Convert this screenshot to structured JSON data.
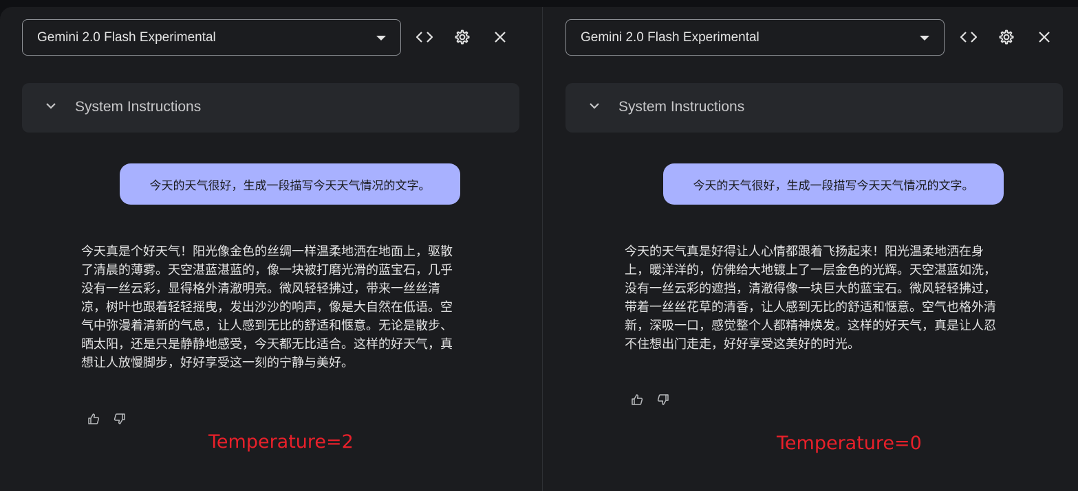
{
  "panes": [
    {
      "model_select": {
        "value": "Gemini 2.0 Flash Experimental"
      },
      "toolbar": {
        "code_icon": "code-icon",
        "settings_icon": "gear-icon",
        "close_icon": "close-icon"
      },
      "system_instructions": {
        "label": "System Instructions"
      },
      "user_message": "今天的天气很好，生成一段描写今天天气情况的文字。",
      "response": "今天真是个好天气！阳光像金色的丝绸一样温柔地洒在地面上，驱散了清晨的薄雾。天空湛蓝湛蓝的，像一块被打磨光滑的蓝宝石，几乎没有一丝云彩，显得格外清澈明亮。微风轻轻拂过，带来一丝丝清凉，树叶也跟着轻轻摇曳，发出沙沙的响声，像是大自然在低语。空气中弥漫着清新的气息，让人感到无比的舒适和惬意。无论是散步、晒太阳，还是只是静静地感受，今天都无比适合。这样的好天气，真想让人放慢脚步，好好享受这一刻的宁静与美好。",
      "feedback": {
        "like_icon": "thumbs-up-icon",
        "dislike_icon": "thumbs-down-icon"
      },
      "annotation": "Temperature=2"
    },
    {
      "model_select": {
        "value": "Gemini 2.0 Flash Experimental"
      },
      "toolbar": {
        "code_icon": "code-icon",
        "settings_icon": "gear-icon",
        "close_icon": "close-icon"
      },
      "system_instructions": {
        "label": "System Instructions"
      },
      "user_message": "今天的天气很好，生成一段描写今天天气情况的文字。",
      "response": "今天的天气真是好得让人心情都跟着飞扬起来！阳光温柔地洒在身上，暖洋洋的，仿佛给大地镀上了一层金色的光辉。天空湛蓝如洗，没有一丝云彩的遮挡，清澈得像一块巨大的蓝宝石。微风轻轻拂过，带着一丝丝花草的清香，让人感到无比的舒适和惬意。空气也格外清新，深吸一口，感觉整个人都精神焕发。这样的好天气，真是让人忍不住想出门走走，好好享受这美好的时光。",
      "feedback": {
        "like_icon": "thumbs-up-icon",
        "dislike_icon": "thumbs-down-icon"
      },
      "annotation": "Temperature=0"
    }
  ],
  "colors": {
    "background": "#1b1c1f",
    "panel": "#26282c",
    "user_bubble": "#a8b1ff",
    "annotation": "#e8202a",
    "text": "#e3e3e3"
  }
}
